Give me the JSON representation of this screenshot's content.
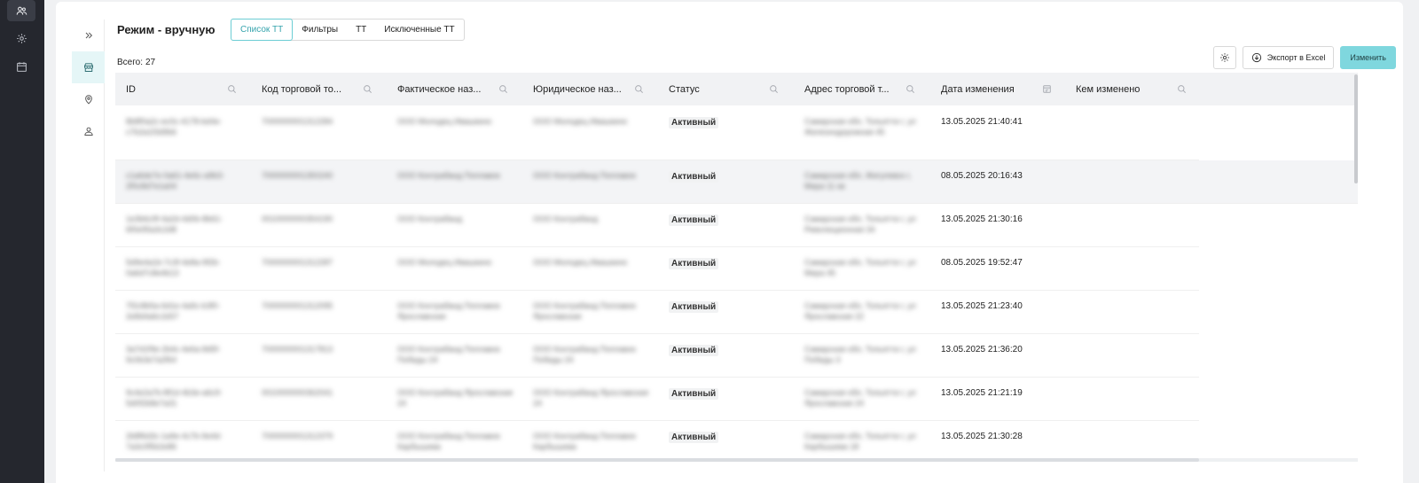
{
  "page": {
    "title": "Режим - вручную",
    "total_label": "Всего:",
    "total_count": "27"
  },
  "tabs": [
    {
      "label": "Список ТТ",
      "active": true
    },
    {
      "label": "Фильтры",
      "active": false
    },
    {
      "label": "ТТ",
      "active": false
    },
    {
      "label": "Исключенные ТТ",
      "active": false
    }
  ],
  "rail_icons": [
    "users-icon",
    "settings-icon",
    "calendar-icon"
  ],
  "subnav_icons": [
    "expand-chevrons-icon",
    "store-icon",
    "location-pin-icon",
    "user-icon"
  ],
  "toolbar": {
    "settings_icon": "gear-icon",
    "export_label": "Экспорт в Excel",
    "export_icon": "download-circle-icon",
    "edit_label": "Изменить"
  },
  "colors": {
    "accent": "#7fd7de",
    "accent_text": "#36a4ad",
    "rail_bg": "#25272e",
    "header_bg": "#f1f2f4"
  },
  "columns": [
    {
      "label": "ID",
      "icon": "search-icon"
    },
    {
      "label": "Код торговой то...",
      "icon": "search-icon"
    },
    {
      "label": "Фактическое наз...",
      "icon": "search-icon"
    },
    {
      "label": "Юридическое наз...",
      "icon": "search-icon"
    },
    {
      "label": "Статус",
      "icon": "search-icon"
    },
    {
      "label": "Адрес торговой т...",
      "icon": "search-icon"
    },
    {
      "label": "Дата изменения",
      "icon": "calendar-icon"
    },
    {
      "label": "Кем изменено",
      "icon": "search-icon"
    }
  ],
  "rows": [
    {
      "id": "8b8f0a2c-ec0c-4178-bd4e-c7b2a1f3d9b6",
      "code": "7000000001312284",
      "fact": "ООО Молодец Ивашкино",
      "jur": "ООО Молодец Ивашкино",
      "status": "Активный",
      "addr": "Самарская обл, Тольятти г, ул Железнодорожная 45",
      "date": "13.05.2025 21:40:41",
      "by": ""
    },
    {
      "id": "c1a6de7e-0a61-4e6c-a9b3-2f0c8d7e1a04",
      "code": "7000000001350240",
      "fact": "ООО Контрабанд Поплавок",
      "jur": "ООО Контрабанд Поплавок",
      "status": "Активный",
      "addr": "Самарская обл, Жигулевск г, Мира 11 кв",
      "date": "08.05.2025 20:16:43",
      "by": ""
    },
    {
      "id": "1e3b6c9f-4a2d-4d0b-8b61-6f0e95a3c2d8",
      "code": "0010000000354190",
      "fact": "ООО Контрабанд",
      "jur": "ООО Контрабанд",
      "status": "Активный",
      "addr": "Самарская обл, Тольятти г, ул Революционная 34",
      "date": "13.05.2025 21:30:16",
      "by": ""
    },
    {
      "id": "5d9e4a1b-7c3f-4e8a-9f2b-0a6d7c8e4b13",
      "code": "7000000001312287",
      "fact": "ООО Молодец Ивашкино",
      "jur": "ООО Молодец Ивашкино",
      "status": "Активный",
      "addr": "Самарская обл, Тольятти г, ул Мира 45",
      "date": "08.05.2025 19:52:47",
      "by": ""
    },
    {
      "id": "7f2c8b5a-6d1e-4a9c-b3f0-2e8d4a6c1b57",
      "code": "7000000001312095",
      "fact": "ООО Контрабанд Поплавок Ярославская",
      "jur": "ООО Контрабанд Поплавок Ярославская",
      "status": "Активный",
      "addr": "Самарская обл, Тольятти г, ул Ярославская 22",
      "date": "13.05.2025 21:23:40",
      "by": ""
    },
    {
      "id": "3a7d1f9e-2b4c-4e6a-8d5f-9c0b3e7a2f64",
      "code": "7000000001317813",
      "fact": "ООО Контрабанд Поплавок Победы 24",
      "jur": "ООО Контрабанд Поплавок Победы 24",
      "status": "Активный",
      "addr": "Самарская обл, Тольятти г, ул Победы 3",
      "date": "13.05.2025 21:36:20",
      "by": ""
    },
    {
      "id": "9c4e2a7b-8f1d-4b3e-a6c9-5d0f2b8e7a31",
      "code": "0010000000362041",
      "fact": "ООО Контрабанд Ярославская 24",
      "jur": "ООО Контрабанд Ярославская 24",
      "status": "Активный",
      "addr": "Самарская обл, Тольятти г, ул Ярославская 24",
      "date": "13.05.2025 21:21:19",
      "by": ""
    },
    {
      "id": "2b8f6d3c-1a9e-4c7b-9e4d-7a3c0f5b2e86",
      "code": "7000000001312379",
      "fact": "ООО Контрабанд Поплавок Карбышева",
      "jur": "ООО Контрабанд Поплавок Карбышева",
      "status": "Активный",
      "addr": "Самарская обл, Тольятти г, ул Карбышева 18",
      "date": "13.05.2025 21:30:28",
      "by": ""
    }
  ]
}
